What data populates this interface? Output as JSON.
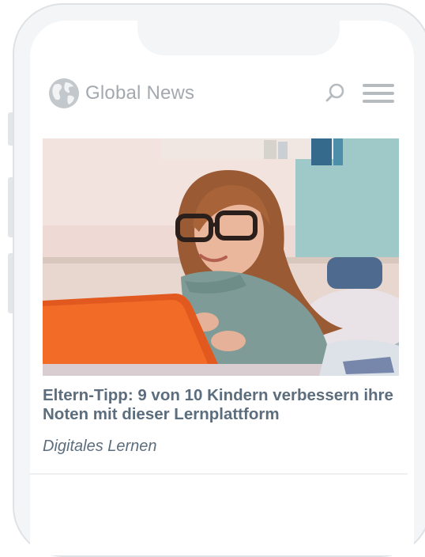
{
  "header": {
    "logo_text": "Global News",
    "logo_icon": "globe-icon",
    "search_icon": "search-icon",
    "menu_icon": "hamburger-menu-icon"
  },
  "article": {
    "image_desc_icon": "article-photo",
    "headline": "Eltern-Tipp: 9 von 10 Kindern verbessern ihre Noten mit dieser Lernplattform",
    "category": "Digitales Lernen"
  },
  "colors": {
    "text": "#5c6d7d",
    "logo": "#a3a9ae",
    "icons": "#b6bbbf"
  }
}
